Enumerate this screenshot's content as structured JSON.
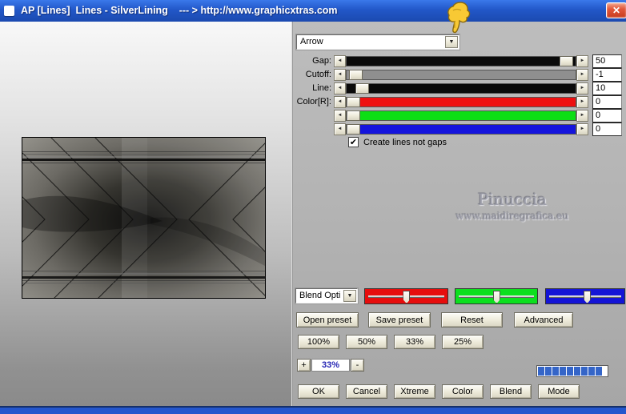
{
  "window": {
    "title": "AP [Lines]  Lines - SilverLining    --- > http://www.graphicxtras.com",
    "titlebar_color": "#2257c8"
  },
  "glyphs": {
    "left_arrow": "◄",
    "right_arrow": "►",
    "dropdown": "▼",
    "check": "✔",
    "close": "✕"
  },
  "preset_dropdown": {
    "value": "Arrow"
  },
  "params": {
    "rows": [
      {
        "label": "Gap:",
        "value": "50",
        "track": "#0a0a0a",
        "thumb_left": "93%"
      },
      {
        "label": "Cutoff:",
        "value": "-1",
        "track": "#8f8f8f",
        "thumb_left": "1%"
      },
      {
        "label": "Line:",
        "value": "10",
        "track": "#0a0a0a",
        "thumb_left": "4%"
      },
      {
        "label": "Color[R]:",
        "value": "0",
        "track": "#ee1010",
        "thumb_left": "0%"
      },
      {
        "label": "",
        "value": "0",
        "track": "#0ddf15",
        "thumb_left": "0%"
      },
      {
        "label": "",
        "value": "0",
        "track": "#1414dd",
        "thumb_left": "0%"
      }
    ],
    "checkbox": {
      "label": "Create lines not gaps",
      "checked": true
    }
  },
  "watermark": {
    "title": "Pinuccia",
    "subtitle": "www.maidiregrafica.eu"
  },
  "blend_panel": {
    "dropdown_value": "Blend Opti",
    "channel_sliders": [
      {
        "name": "red",
        "color": "#e60d0d",
        "thumb_left": "46%"
      },
      {
        "name": "green",
        "color": "#0cdf1e",
        "thumb_left": "46%"
      },
      {
        "name": "blue",
        "color": "#1414d6",
        "thumb_left": "48%"
      }
    ],
    "preset_buttons": [
      "Open preset",
      "Save preset",
      "Reset",
      "Advanced"
    ],
    "zoom_buttons": [
      "100%",
      "50%",
      "33%",
      "25%"
    ],
    "zoom_stepper": {
      "plus": "+",
      "value": "33%",
      "minus": "-"
    },
    "action_buttons": [
      "OK",
      "Cancel",
      "Xtreme",
      "Color",
      "Blend",
      "Mode"
    ],
    "progress_segments": 9
  }
}
